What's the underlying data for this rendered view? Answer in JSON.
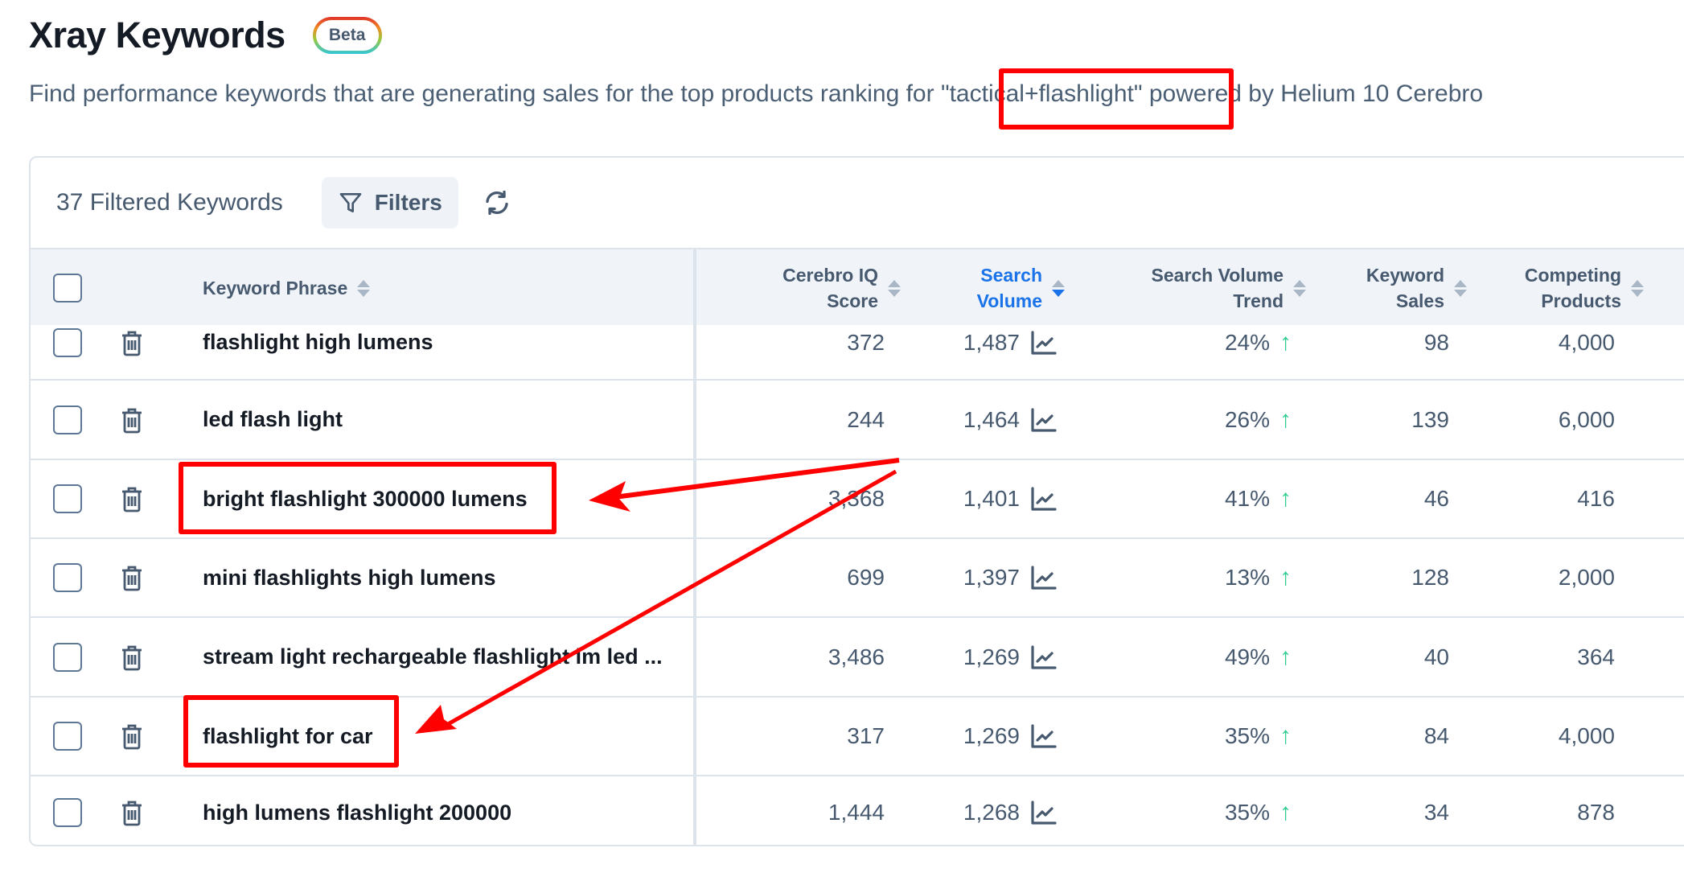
{
  "header": {
    "title": "Xray Keywords",
    "badge": "Beta",
    "subtitle_before": "Find performance keywords that are generating sales for the top products ranking for ",
    "subtitle_query": "\"tactical+flashlight\"",
    "subtitle_after": " powered by Helium 10 Cerebro"
  },
  "toolbar": {
    "count_label": "37 Filtered Keywords",
    "filters_label": "Filters",
    "filter_icon": "funnel-icon",
    "refresh_icon": "refresh-icon"
  },
  "table": {
    "columns": [
      {
        "key": "keyword",
        "label": "Keyword Phrase"
      },
      {
        "key": "cerebro_iq",
        "label_line1": "Cerebro IQ",
        "label_line2": "Score"
      },
      {
        "key": "search_volume",
        "label_line1": "Search",
        "label_line2": "Volume",
        "sorted": "desc"
      },
      {
        "key": "sv_trend",
        "label_line1": "Search Volume",
        "label_line2": "Trend"
      },
      {
        "key": "keyword_sales",
        "label_line1": "Keyword",
        "label_line2": "Sales"
      },
      {
        "key": "competing",
        "label_line1": "Competing",
        "label_line2": "Products"
      }
    ],
    "rows": [
      {
        "keyword": "flashlight high lumens",
        "cerebro_iq": "372",
        "search_volume": "1,487",
        "sv_trend": "24%",
        "keyword_sales": "98",
        "competing": "4,000"
      },
      {
        "keyword": "led flash light",
        "cerebro_iq": "244",
        "search_volume": "1,464",
        "sv_trend": "26%",
        "keyword_sales": "139",
        "competing": "6,000"
      },
      {
        "keyword": "bright flashlight 300000 lumens",
        "cerebro_iq": "3,368",
        "search_volume": "1,401",
        "sv_trend": "41%",
        "keyword_sales": "46",
        "competing": "416"
      },
      {
        "keyword": "mini flashlights high lumens",
        "cerebro_iq": "699",
        "search_volume": "1,397",
        "sv_trend": "13%",
        "keyword_sales": "128",
        "competing": "2,000"
      },
      {
        "keyword": "stream light rechargeable flashlight lm led ...",
        "cerebro_iq": "3,486",
        "search_volume": "1,269",
        "sv_trend": "49%",
        "keyword_sales": "40",
        "competing": "364"
      },
      {
        "keyword": "flashlight for car",
        "cerebro_iq": "317",
        "search_volume": "1,269",
        "sv_trend": "35%",
        "keyword_sales": "84",
        "competing": "4,000"
      },
      {
        "keyword": "high lumens flashlight 200000",
        "cerebro_iq": "1,444",
        "search_volume": "1,268",
        "sv_trend": "35%",
        "keyword_sales": "34",
        "competing": "878"
      }
    ],
    "trend_direction_icon": "arrow-up-icon",
    "row_action_icon": "trash-icon",
    "volume_chart_icon": "line-chart-icon"
  },
  "annotations": {
    "color": "#ff0000",
    "highlighted": [
      "\"tactical+flashlight\"",
      "bright flashlight 300000 lumens",
      "flashlight for car"
    ]
  },
  "colors": {
    "accent": "#1a73e8",
    "trend_up": "#2ecc8f",
    "text": "#46596f",
    "heading": "#151b24"
  }
}
